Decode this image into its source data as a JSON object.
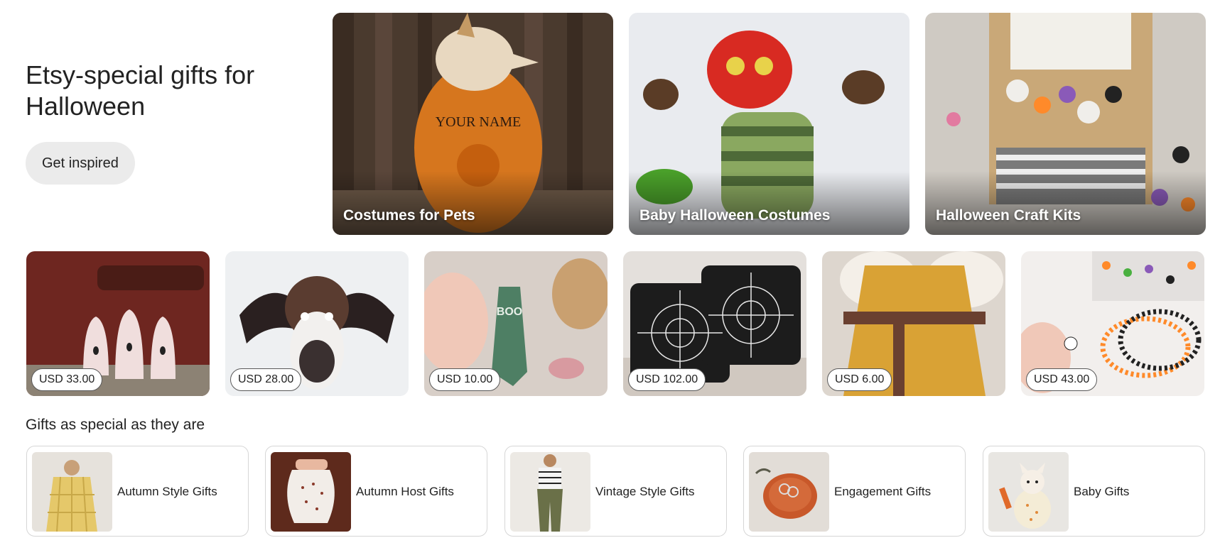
{
  "hero": {
    "title": "Etsy-special gifts for Halloween",
    "cta_label": "Get inspired"
  },
  "categories": [
    {
      "label": "Costumes for Pets",
      "image": "dog-in-pumpkin-hoodie"
    },
    {
      "label": "Baby Halloween Costumes",
      "image": "crochet-caterpillar-baby-costume"
    },
    {
      "label": "Halloween Craft Kits",
      "image": "ghost-garland-craft-kit"
    }
  ],
  "items": [
    {
      "price": "USD 33.00",
      "image": "clay-ghost-figurines"
    },
    {
      "price": "USD 28.00",
      "image": "cat-bat-hat"
    },
    {
      "price": "USD 10.00",
      "image": "boo-witch-keychain"
    },
    {
      "price": "USD 102.00",
      "image": "spiderweb-pillows"
    },
    {
      "price": "USD 6.00",
      "image": "renaissance-dress-belt"
    },
    {
      "price": "USD 43.00",
      "image": "spooky-bead-bracelets"
    }
  ],
  "gifts_section": {
    "title": "Gifts as special as they are",
    "cards": [
      {
        "label": "Autumn Style Gifts",
        "image": "plaid-coat"
      },
      {
        "label": "Autumn Host Gifts",
        "image": "ceramic-vase"
      },
      {
        "label": "Vintage Style Gifts",
        "image": "olive-trousers"
      },
      {
        "label": "Engagement Gifts",
        "image": "ring-dish"
      },
      {
        "label": "Baby Gifts",
        "image": "plush-doll"
      }
    ]
  },
  "colors": {
    "button_bg": "#ebebeb",
    "text": "#222222",
    "card_border": "#d6d6d6"
  }
}
